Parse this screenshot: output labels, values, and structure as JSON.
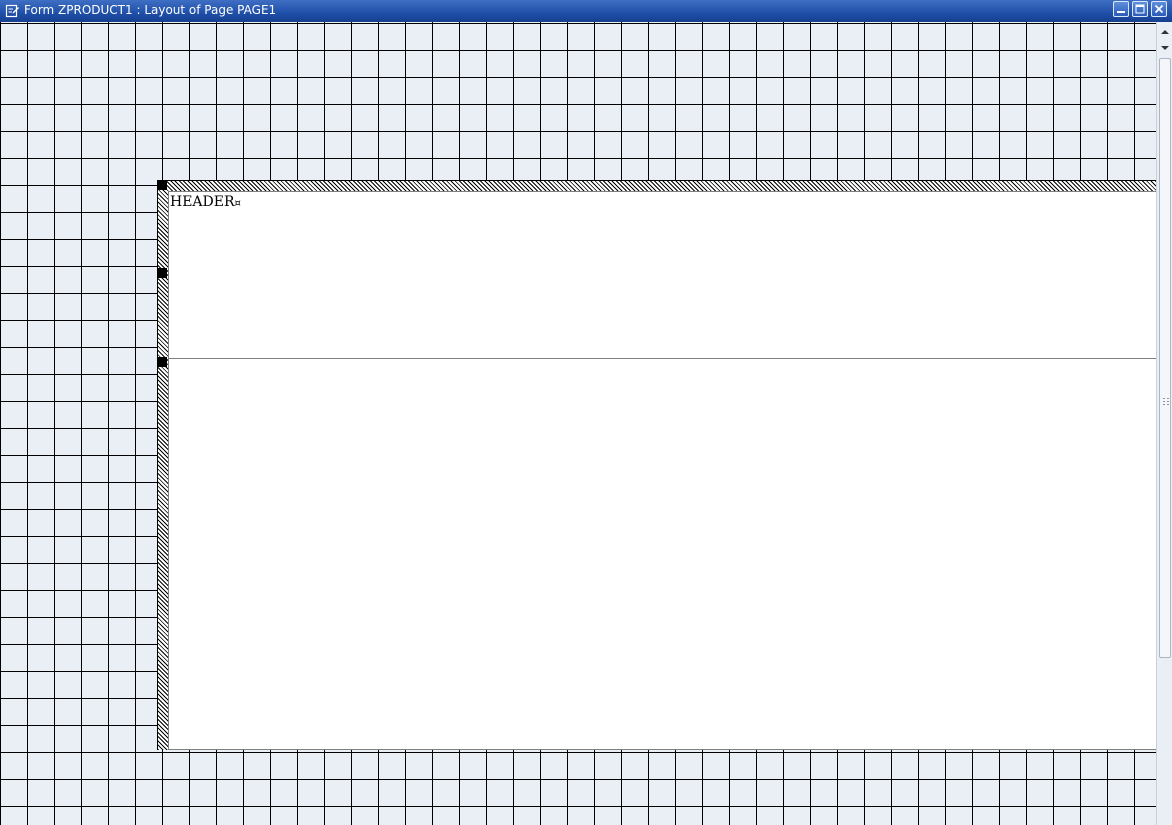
{
  "window": {
    "title": "Form ZPRODUCT1 : Layout of Page PAGE1",
    "title_icon": "edit-document-icon",
    "minimize_icon": "minimize-icon",
    "maximize_icon": "maximize-icon",
    "close_icon": "close-icon"
  },
  "layout": {
    "header_window_label": "HEADER",
    "paragraph_mark": "¤"
  },
  "colors": {
    "titlebar": "#1f4fa8",
    "grid_background": "#eaeff5",
    "grid_lines": "#000000",
    "page": "#ffffff"
  },
  "scrollbar": {
    "up_icon": "arrow-up-icon",
    "down_icon": "arrow-down-icon"
  }
}
